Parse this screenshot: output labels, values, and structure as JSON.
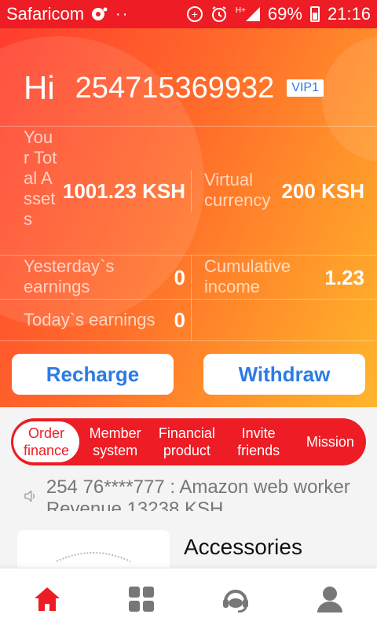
{
  "status_bar": {
    "carrier": "Safaricom",
    "network": "H+",
    "battery": "69%",
    "time": "21:16"
  },
  "header": {
    "greeting": "Hi",
    "phone": "254715369932",
    "vip": "VIP1"
  },
  "stats": {
    "total_assets_label": "Your Total Assets",
    "total_assets_value": "1001.23 KSH",
    "virtual_currency_label": "Virtual currency",
    "virtual_currency_value": "200 KSH",
    "yesterday_label": "Yesterday`s earnings",
    "yesterday_value": "0",
    "cumulative_label": "Cumulative income",
    "cumulative_value": "1.23",
    "today_label": "Today`s earnings",
    "today_value": "0"
  },
  "actions": {
    "recharge": "Recharge",
    "withdraw": "Withdraw"
  },
  "tabs": [
    {
      "label": "Order finance",
      "active": true
    },
    {
      "label": "Member system",
      "active": false
    },
    {
      "label": "Financial product",
      "active": false
    },
    {
      "label": "Invite friends",
      "active": false
    },
    {
      "label": "Mission",
      "active": false
    }
  ],
  "ticker": {
    "text": "254 76****777 : Amazon web worker Revenue 13238 KSH"
  },
  "product": {
    "title": "Accessories"
  },
  "bottom_nav": [
    {
      "icon": "home-icon",
      "active": true
    },
    {
      "icon": "grid-icon",
      "active": false
    },
    {
      "icon": "support-icon",
      "active": false
    },
    {
      "icon": "user-icon",
      "active": false
    }
  ],
  "colors": {
    "red": "#ee1c24",
    "blue": "#2d7be5",
    "gradient_start": "#ff3d2e",
    "gradient_end": "#ffb52c"
  }
}
